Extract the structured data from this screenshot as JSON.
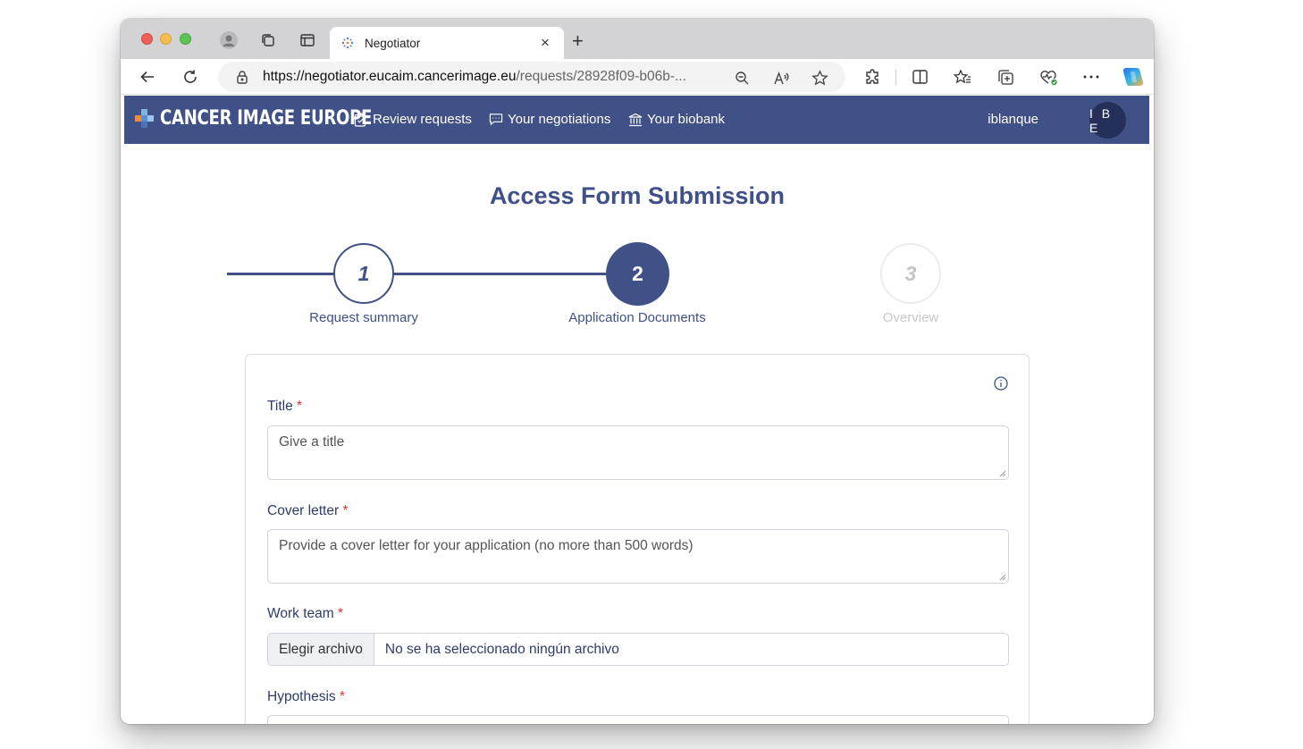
{
  "browser": {
    "tab_title": "Negotiator",
    "tab_close": "×",
    "new_tab": "+",
    "url_host": "https://negotiator.eucaim.cancerimage.eu",
    "url_path": "/requests/28928f09-b06b-...",
    "icons": [
      "back-icon",
      "reload-icon",
      "lock-icon",
      "zoom-out-icon",
      "read-aloud-icon",
      "favorite-star-icon",
      "extensions-icon",
      "split-screen-icon",
      "favorites-icon",
      "collections-icon",
      "browser-essentials-icon",
      "more-icon",
      "copilot-icon"
    ]
  },
  "navbar": {
    "brand": "CANCER IMAGE EUROPE",
    "links": [
      {
        "label": "Review requests",
        "icon": "clipboard-icon"
      },
      {
        "label": "Your negotiations",
        "icon": "chat-icon"
      },
      {
        "label": "Your biobank",
        "icon": "bank-icon"
      }
    ],
    "username": "iblanque",
    "avatar_initials": "I B E",
    "colors": {
      "navbar": "#3f5186",
      "avatar": "#24305a"
    }
  },
  "page": {
    "title": "Access Form Submission",
    "steps": [
      {
        "number": "1",
        "label": "Request summary",
        "state": "completed"
      },
      {
        "number": "2",
        "label": "Application Documents",
        "state": "active"
      },
      {
        "number": "3",
        "label": "Overview",
        "state": "pending"
      }
    ],
    "form": {
      "title_label": "Title",
      "title_placeholder": "Give a title",
      "cover_label": "Cover letter",
      "cover_placeholder": "Provide a cover letter for your application (no more than 500 words)",
      "work_team_label": "Work team",
      "file_button": "Elegir archivo",
      "file_status": "No se ha seleccionado ningún archivo",
      "hypothesis_label": "Hypothesis",
      "required_mark": "*"
    }
  }
}
